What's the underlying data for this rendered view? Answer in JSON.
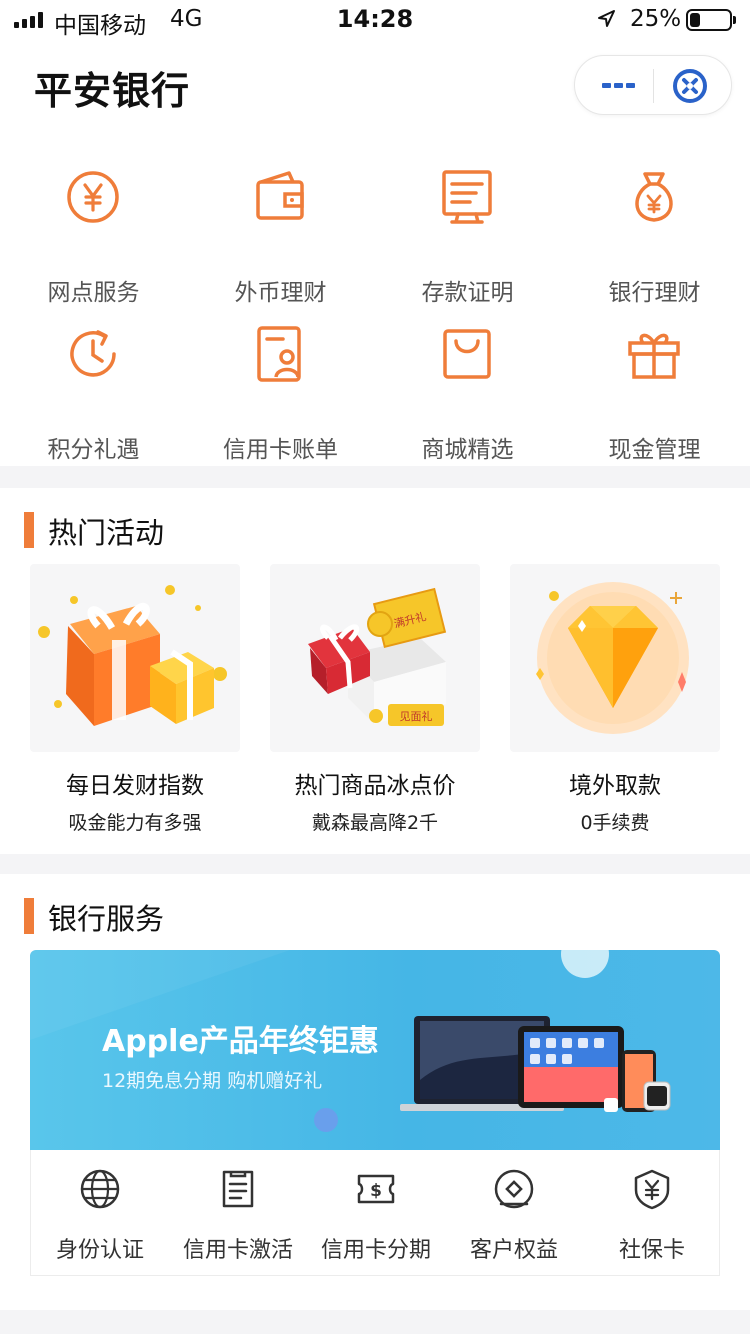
{
  "status_bar": {
    "carrier": "中国移动",
    "network": "4G",
    "time": "14:28",
    "battery_percent": "25%",
    "battery_level": 0.25
  },
  "header": {
    "title": "平安银行"
  },
  "quick_menu": [
    {
      "label": "网点服务",
      "icon": "yen-coin-icon"
    },
    {
      "label": "外币理财",
      "icon": "wallet-icon"
    },
    {
      "label": "存款证明",
      "icon": "certificate-icon"
    },
    {
      "label": "银行理财",
      "icon": "money-bag-icon"
    },
    {
      "label": "积分礼遇",
      "icon": "clock-rotate-icon"
    },
    {
      "label": "信用卡账单",
      "icon": "card-user-icon"
    },
    {
      "label": "商城精选",
      "icon": "shopping-bag-icon"
    },
    {
      "label": "现金管理",
      "icon": "gift-icon"
    }
  ],
  "hot_activities": {
    "title": "热门活动",
    "items": [
      {
        "title": "每日发财指数",
        "subtitle": "吸金能力有多强"
      },
      {
        "title": "热门商品冰点价",
        "subtitle": "戴森最高降2千",
        "image_text": [
          "满升礼",
          "见面礼"
        ]
      },
      {
        "title": "境外取款",
        "subtitle": "0手续费"
      }
    ]
  },
  "bank_services": {
    "title": "银行服务",
    "banner": {
      "title": "Apple产品年终钜惠",
      "subtitle": "12期免息分期 购机赠好礼"
    },
    "items": [
      {
        "label": "身份认证",
        "icon": "globe-icon"
      },
      {
        "label": "信用卡激活",
        "icon": "document-icon"
      },
      {
        "label": "信用卡分期",
        "icon": "dollar-ticket-icon"
      },
      {
        "label": "客户权益",
        "icon": "badge-icon"
      },
      {
        "label": "社保卡",
        "icon": "yen-shield-icon"
      }
    ]
  },
  "colors": {
    "accent": "#ef7d3a",
    "brand_blue": "#2a62c9",
    "banner_blue": "#45b6e6"
  }
}
